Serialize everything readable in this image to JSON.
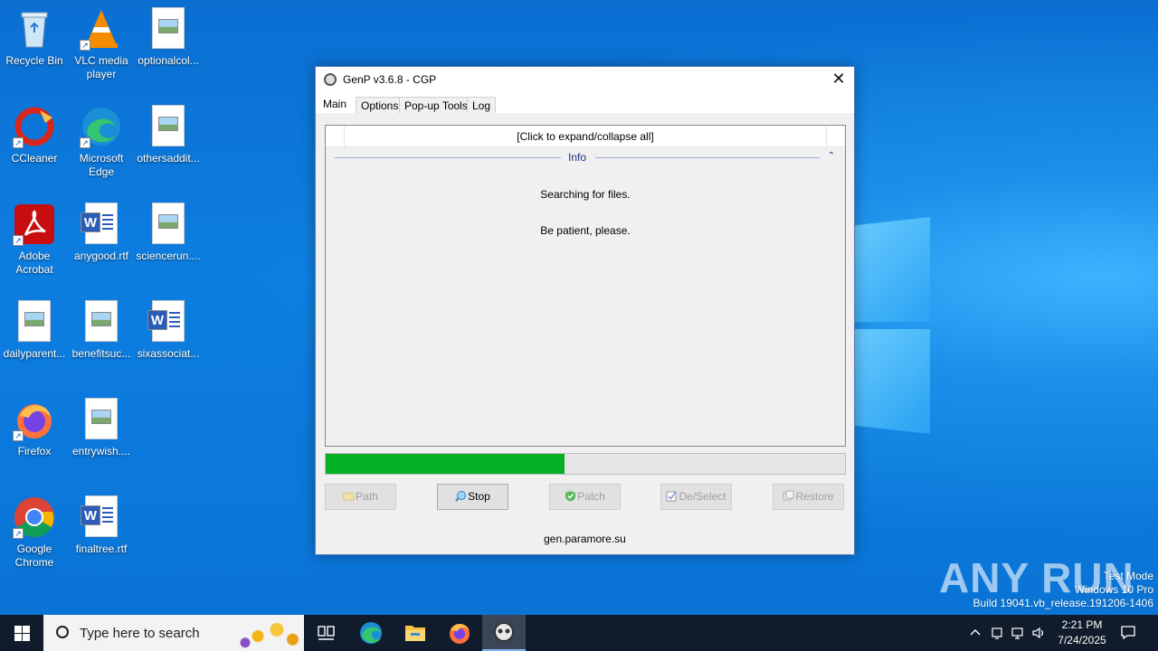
{
  "desktop": {
    "icons": [
      {
        "label": "Recycle Bin"
      },
      {
        "label": "VLC media player"
      },
      {
        "label": "optionalcol..."
      },
      {
        "label": "CCleaner"
      },
      {
        "label": "Microsoft Edge"
      },
      {
        "label": "othersaddit..."
      },
      {
        "label": "Adobe Acrobat"
      },
      {
        "label": "anygood.rtf"
      },
      {
        "label": "sciencerun...."
      },
      {
        "label": "dailyparent..."
      },
      {
        "label": "benefitsuc..."
      },
      {
        "label": "sixassociat..."
      },
      {
        "label": "Firefox"
      },
      {
        "label": "entrywish...."
      },
      {
        "label": "Google Chrome"
      },
      {
        "label": "finaltree.rtf"
      }
    ]
  },
  "window": {
    "title": "GenP v3.6.8 - CGP",
    "close_glyph": "✕",
    "tabs": [
      {
        "label": "Main",
        "active": true
      },
      {
        "label": "Options",
        "active": false
      },
      {
        "label": "Pop-up Tools",
        "active": false
      },
      {
        "label": "Log",
        "active": false
      }
    ],
    "expand_all_label": "[Click to expand/collapse all]",
    "group": {
      "label": "Info",
      "chevron": "⌃"
    },
    "messages": [
      "Searching for files.",
      "Be patient, please."
    ],
    "progress_percent": 46,
    "buttons": [
      {
        "label": "Path",
        "enabled": false,
        "icon": "folder-icon"
      },
      {
        "label": "Stop",
        "enabled": true,
        "icon": "search-icon"
      },
      {
        "label": "Patch",
        "enabled": false,
        "icon": "shield-check-icon"
      },
      {
        "label": "De/Select",
        "enabled": false,
        "icon": "checkbox-icon"
      },
      {
        "label": "Restore",
        "enabled": false,
        "icon": "restore-icon"
      }
    ],
    "footer_link": "gen.paramore.su"
  },
  "watermark": {
    "logo": "ANY RUN",
    "line1": "Test Mode",
    "line2": "Windows 10 Pro",
    "line3": "Build 19041.vb_release.191206-1406"
  },
  "taskbar": {
    "search_placeholder": "Type here to search",
    "time": "2:21 PM",
    "date": "7/24/2025",
    "pinned": [
      "task-view-icon",
      "edge-icon",
      "file-explorer-icon",
      "firefox-icon",
      "genp-icon"
    ]
  },
  "colors": {
    "progress_fill": "#06b025",
    "group_accent": "#1e3287",
    "desktop_bg": "#0a78d7"
  }
}
